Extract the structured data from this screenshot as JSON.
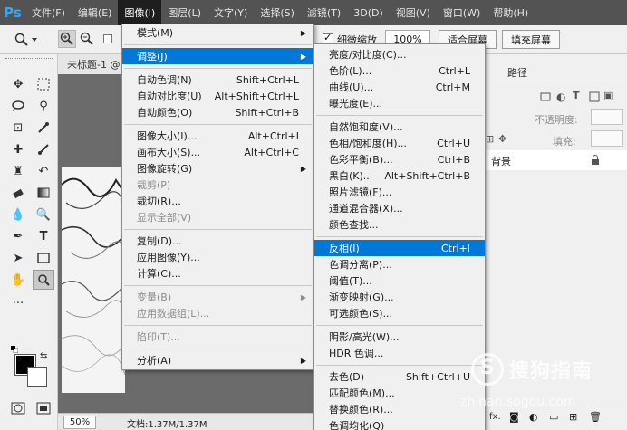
{
  "app": {
    "logo": "Ps"
  },
  "menubar": {
    "items": [
      "文件(F)",
      "编辑(E)",
      "图像(I)",
      "图层(L)",
      "文字(Y)",
      "选择(S)",
      "滤镜(T)",
      "3D(D)",
      "视图(V)",
      "窗口(W)",
      "帮助(H)"
    ],
    "active_index": 2
  },
  "options": {
    "checkbox_label": "细微缩放",
    "zoom_value": "100%",
    "fit_screen": "适合屏幕",
    "fill_screen": "填充屏幕"
  },
  "document": {
    "tab_title": "未标题-1 @",
    "zoom": "50%",
    "doc_info": "文档:1.37M/1.37M"
  },
  "panel": {
    "tab_paths": "路径",
    "opacity_label": "不透明度:",
    "fill_label": "填充:",
    "layer_name": "背景"
  },
  "image_menu": {
    "items": [
      {
        "label": "模式(M)",
        "shortcut": "",
        "submenu": true,
        "disabled": false,
        "highlight": false
      },
      {
        "sep": true
      },
      {
        "label": "调整(J)",
        "shortcut": "",
        "submenu": true,
        "disabled": false,
        "highlight": true
      },
      {
        "sep": true
      },
      {
        "label": "自动色调(N)",
        "shortcut": "Shift+Ctrl+L",
        "submenu": false,
        "disabled": false,
        "highlight": false
      },
      {
        "label": "自动对比度(U)",
        "shortcut": "Alt+Shift+Ctrl+L",
        "submenu": false,
        "disabled": false,
        "highlight": false
      },
      {
        "label": "自动颜色(O)",
        "shortcut": "Shift+Ctrl+B",
        "submenu": false,
        "disabled": false,
        "highlight": false
      },
      {
        "sep": true
      },
      {
        "label": "图像大小(I)...",
        "shortcut": "Alt+Ctrl+I",
        "submenu": false,
        "disabled": false,
        "highlight": false
      },
      {
        "label": "画布大小(S)...",
        "shortcut": "Alt+Ctrl+C",
        "submenu": false,
        "disabled": false,
        "highlight": false
      },
      {
        "label": "图像旋转(G)",
        "shortcut": "",
        "submenu": true,
        "disabled": false,
        "highlight": false
      },
      {
        "label": "裁剪(P)",
        "shortcut": "",
        "submenu": false,
        "disabled": true,
        "highlight": false
      },
      {
        "label": "裁切(R)...",
        "shortcut": "",
        "submenu": false,
        "disabled": false,
        "highlight": false
      },
      {
        "label": "显示全部(V)",
        "shortcut": "",
        "submenu": false,
        "disabled": true,
        "highlight": false
      },
      {
        "sep": true
      },
      {
        "label": "复制(D)...",
        "shortcut": "",
        "submenu": false,
        "disabled": false,
        "highlight": false
      },
      {
        "label": "应用图像(Y)...",
        "shortcut": "",
        "submenu": false,
        "disabled": false,
        "highlight": false
      },
      {
        "label": "计算(C)...",
        "shortcut": "",
        "submenu": false,
        "disabled": false,
        "highlight": false
      },
      {
        "sep": true
      },
      {
        "label": "变量(B)",
        "shortcut": "",
        "submenu": true,
        "disabled": true,
        "highlight": false
      },
      {
        "label": "应用数据组(L)...",
        "shortcut": "",
        "submenu": false,
        "disabled": true,
        "highlight": false
      },
      {
        "sep": true
      },
      {
        "label": "陷印(T)...",
        "shortcut": "",
        "submenu": false,
        "disabled": true,
        "highlight": false
      },
      {
        "sep": true
      },
      {
        "label": "分析(A)",
        "shortcut": "",
        "submenu": true,
        "disabled": false,
        "highlight": false
      }
    ]
  },
  "adjust_menu": {
    "items": [
      {
        "label": "亮度/对比度(C)...",
        "shortcut": "",
        "highlight": false
      },
      {
        "label": "色阶(L)...",
        "shortcut": "Ctrl+L",
        "highlight": false
      },
      {
        "label": "曲线(U)...",
        "shortcut": "Ctrl+M",
        "highlight": false
      },
      {
        "label": "曝光度(E)...",
        "shortcut": "",
        "highlight": false
      },
      {
        "sep": true
      },
      {
        "label": "自然饱和度(V)...",
        "shortcut": "",
        "highlight": false
      },
      {
        "label": "色相/饱和度(H)...",
        "shortcut": "Ctrl+U",
        "highlight": false
      },
      {
        "label": "色彩平衡(B)...",
        "shortcut": "Ctrl+B",
        "highlight": false
      },
      {
        "label": "黑白(K)...",
        "shortcut": "Alt+Shift+Ctrl+B",
        "highlight": false
      },
      {
        "label": "照片滤镜(F)...",
        "shortcut": "",
        "highlight": false
      },
      {
        "label": "通道混合器(X)...",
        "shortcut": "",
        "highlight": false
      },
      {
        "label": "颜色查找...",
        "shortcut": "",
        "highlight": false
      },
      {
        "sep": true
      },
      {
        "label": "反相(I)",
        "shortcut": "Ctrl+I",
        "highlight": true
      },
      {
        "label": "色调分离(P)...",
        "shortcut": "",
        "highlight": false
      },
      {
        "label": "阈值(T)...",
        "shortcut": "",
        "highlight": false
      },
      {
        "label": "渐变映射(G)...",
        "shortcut": "",
        "highlight": false
      },
      {
        "label": "可选颜色(S)...",
        "shortcut": "",
        "highlight": false
      },
      {
        "sep": true
      },
      {
        "label": "阴影/高光(W)...",
        "shortcut": "",
        "highlight": false
      },
      {
        "label": "HDR 色调...",
        "shortcut": "",
        "highlight": false
      },
      {
        "sep": true
      },
      {
        "label": "去色(D)",
        "shortcut": "Shift+Ctrl+U",
        "highlight": false
      },
      {
        "label": "匹配颜色(M)...",
        "shortcut": "",
        "highlight": false
      },
      {
        "label": "替换颜色(R)...",
        "shortcut": "",
        "highlight": false
      },
      {
        "label": "色调均化(Q)",
        "shortcut": "",
        "highlight": false
      }
    ]
  },
  "watermark": {
    "brand": "搜狗指南",
    "url": "zhinan.sogou.com"
  },
  "colors": {
    "highlight": "#0078d7",
    "menubar": "#535353",
    "ps_blue": "#31a8ff"
  }
}
